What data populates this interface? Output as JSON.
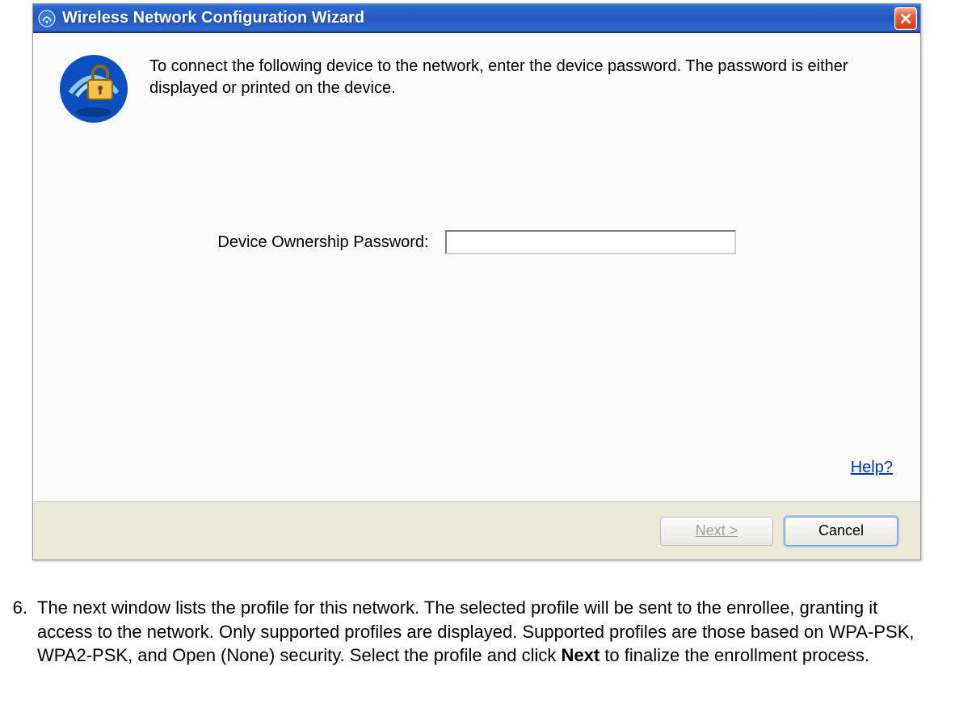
{
  "dialog": {
    "title": "Wireless Network Configuration Wizard",
    "instruction": "To connect the following device to the network, enter the device password. The password is either displayed or printed on the device.",
    "password_label": "Device Ownership Password:",
    "password_value": "",
    "help_label": "Help?",
    "next_label": "Next >",
    "cancel_label": "Cancel"
  },
  "doc": {
    "step_number": "6.",
    "step_text_before_bold": "The next window lists the profile for this network. The selected profile will be sent to the enrollee, granting it access to the network. Only supported profiles are displayed. Supported profiles are those based on WPA-PSK, WPA2-PSK, and Open (None) security. Select the profile and click ",
    "step_bold": "Next",
    "step_text_after_bold": " to finalize the enrollment process."
  }
}
